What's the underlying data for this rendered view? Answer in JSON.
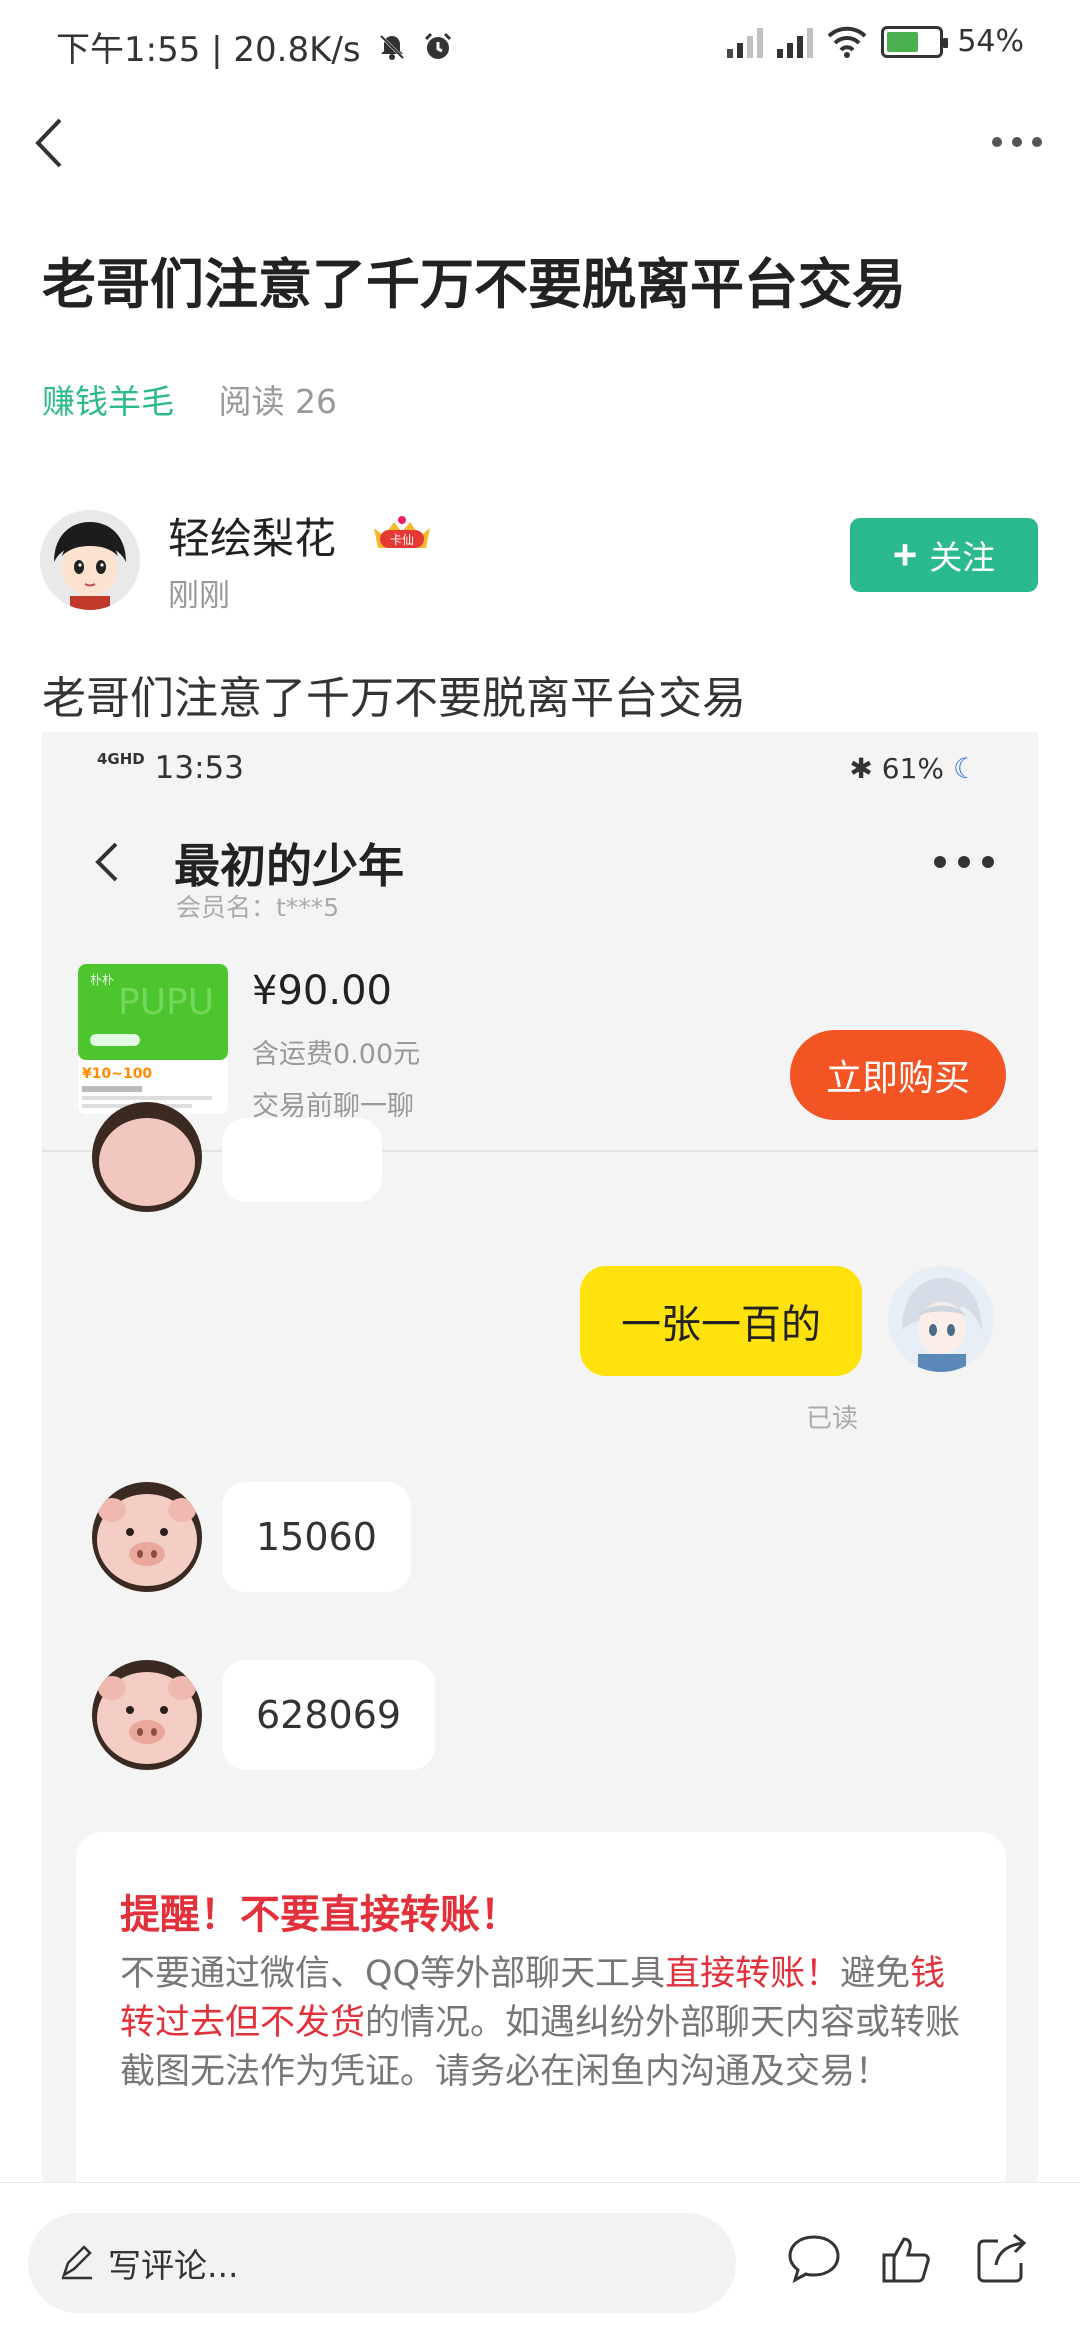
{
  "status_bar": {
    "time_net": "下午1:55 | 20.8K/s",
    "battery": "54%",
    "battery_level": 0.54
  },
  "nav": {
    "back_icon": "chevron-left-icon",
    "more_icon": "more-horizontal-icon"
  },
  "post": {
    "title": "老哥们注意了千万不要脱离平台交易",
    "category": "赚钱羊毛",
    "reads": "阅读 26",
    "text": "老哥们注意了千万不要脱离平台交易"
  },
  "author": {
    "name": "轻绘梨花",
    "badge": "卡仙",
    "time": "刚刚",
    "follow_label": "关注"
  },
  "screenshot": {
    "status_time": "13:53",
    "status_net": "4GHD",
    "status_battery": "61%",
    "seller_name": "最初的少年",
    "member_name": "会员名：t***5",
    "thumb_text": "¥10~100",
    "price": "¥90.00",
    "shipping": "含运费0.00元",
    "chat_hint": "交易前聊一聊",
    "buy_label": "立即购买",
    "messages": [
      {
        "side": "right",
        "text": "一张一百的",
        "status": "已读"
      },
      {
        "side": "left",
        "text": "15060"
      },
      {
        "side": "left",
        "text": "628069"
      }
    ],
    "warning": {
      "title": "提醒！不要直接转账！",
      "seg1": "不要通过微信、QQ等外部聊天工具",
      "seg2": "直接转账！",
      "seg3": "避免",
      "seg4": "钱转过去但不发货",
      "seg5": "的情况。如遇纠纷外部聊天内容或转账截图无法作为凭证。请务必在闲鱼内沟通及交易！"
    }
  },
  "bottom_bar": {
    "comment_placeholder": "写评论...",
    "icons": [
      "comment-icon",
      "like-icon",
      "share-icon"
    ]
  },
  "colors": {
    "accent": "#2bb98e",
    "buy_button": "#f25424",
    "my_bubble": "#ffe20b",
    "warning_red": "#e2313b"
  }
}
